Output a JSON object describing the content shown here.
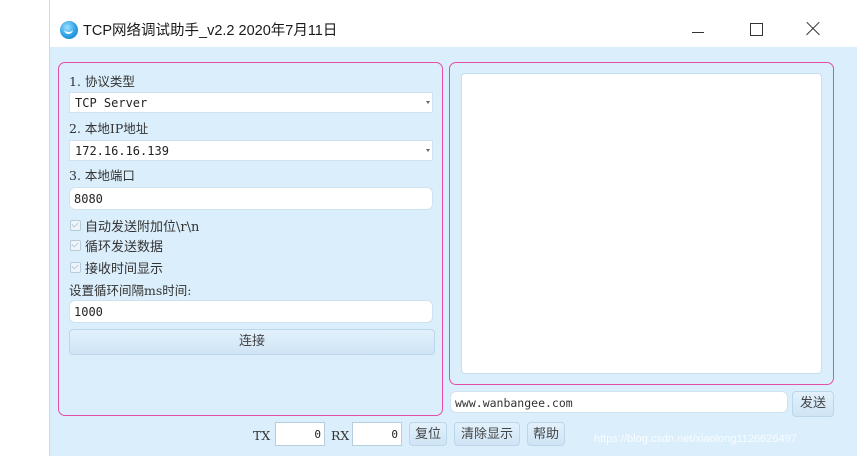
{
  "window": {
    "title": "TCP网络调试助手_v2.2 2020年7月11日",
    "minimize_glyph": "minimize-icon",
    "maximize_glyph": "maximize-icon",
    "close_glyph": "close-icon"
  },
  "settings": {
    "protocol_label": "1. 协议类型",
    "protocol_value": "TCP Server",
    "ip_label": "2. 本地IP地址",
    "ip_value": "172.16.16.139",
    "port_label": "3. 本地端口",
    "port_value": "8080",
    "options": [
      {
        "label": "自动发送附加位\\r\\n",
        "checked": false
      },
      {
        "label": "循环发送数据",
        "checked": false
      },
      {
        "label": "接收时间显示",
        "checked": false
      }
    ],
    "interval_label": "设置循环间隔ms时间:",
    "interval_value": "1000",
    "connect_label": "连接"
  },
  "receive": {
    "content": ""
  },
  "send": {
    "input_value": "www.wanbangee.com",
    "send_label": "发送"
  },
  "status": {
    "tx_label": "TX",
    "tx_value": "0",
    "rx_label": "RX",
    "rx_value": "0",
    "reset_label": "复位",
    "clear_label": "清除显示",
    "help_label": "帮助"
  },
  "watermark": "https://blog.csdn.net/xiaolong1126626497",
  "colors": {
    "window_bg": "#dbeefb",
    "panel_border": "#e34fa8"
  }
}
